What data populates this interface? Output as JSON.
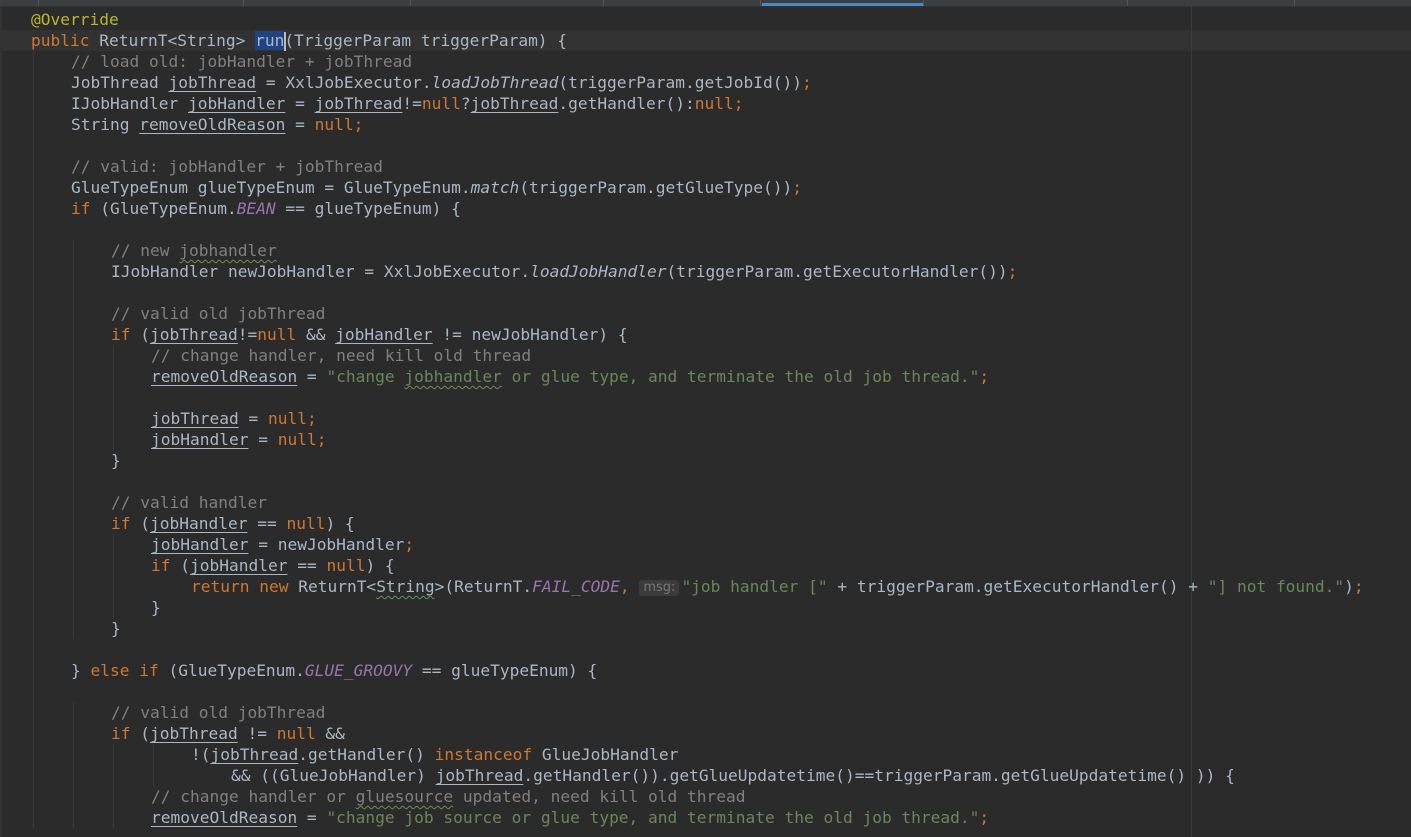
{
  "editor": {
    "language": "Java",
    "colors": {
      "background": "#2b2b2b",
      "keyword": "#cc7832",
      "annotation": "#bbb529",
      "comment": "#808080",
      "string": "#6a8759",
      "static_field": "#9876aa",
      "default_text": "#a9b7c6",
      "selection": "#214283"
    },
    "selected_identifier": "run",
    "parameter_hint": "msg:",
    "lines": [
      {
        "indent": 0,
        "tokens": [
          {
            "t": "@Override",
            "c": "ann"
          }
        ]
      },
      {
        "indent": 0,
        "tokens": [
          {
            "t": "public",
            "c": "kw"
          },
          {
            "t": " ReturnT<String> "
          },
          {
            "t": "run",
            "c": "sel"
          },
          {
            "t": "(TriggerParam triggerParam) {"
          }
        ]
      },
      {
        "indent": 1,
        "tokens": [
          {
            "t": "// load old: jobHandler + jobThread",
            "c": "cmt"
          }
        ]
      },
      {
        "indent": 1,
        "tokens": [
          {
            "t": "JobThread "
          },
          {
            "t": "jobThread",
            "c": "var"
          },
          {
            "t": " = XxlJobExecutor."
          },
          {
            "t": "loadJobThread",
            "c": "italic-method"
          },
          {
            "t": "(triggerParam.getJobId())"
          },
          {
            "t": ";",
            "c": "kw"
          }
        ]
      },
      {
        "indent": 1,
        "tokens": [
          {
            "t": "IJobHandler "
          },
          {
            "t": "jobHandler",
            "c": "var"
          },
          {
            "t": " = "
          },
          {
            "t": "jobThread",
            "c": "var"
          },
          {
            "t": "!="
          },
          {
            "t": "null",
            "c": "kw"
          },
          {
            "t": "?"
          },
          {
            "t": "jobThread",
            "c": "var"
          },
          {
            "t": ".getHandler():"
          },
          {
            "t": "null;",
            "c": "kw"
          }
        ]
      },
      {
        "indent": 1,
        "tokens": [
          {
            "t": "String "
          },
          {
            "t": "removeOldReason",
            "c": "var"
          },
          {
            "t": " = "
          },
          {
            "t": "null;",
            "c": "kw"
          }
        ]
      },
      {
        "indent": 0,
        "tokens": []
      },
      {
        "indent": 1,
        "tokens": [
          {
            "t": "// valid: jobHandler + jobThread",
            "c": "cmt"
          }
        ]
      },
      {
        "indent": 1,
        "tokens": [
          {
            "t": "GlueTypeEnum glueTypeEnum = GlueTypeEnum."
          },
          {
            "t": "match",
            "c": "italic-method"
          },
          {
            "t": "(triggerParam.getGlueType())"
          },
          {
            "t": ";",
            "c": "kw"
          }
        ]
      },
      {
        "indent": 1,
        "tokens": [
          {
            "t": "if",
            "c": "kw"
          },
          {
            "t": " (GlueTypeEnum."
          },
          {
            "t": "BEAN",
            "c": "static-field"
          },
          {
            "t": " == glueTypeEnum) {"
          }
        ]
      },
      {
        "indent": 0,
        "tokens": []
      },
      {
        "indent": 2,
        "tokens": [
          {
            "t": "// new ",
            "c": "cmt"
          },
          {
            "t": "jobhandler",
            "c": "cmt typo"
          }
        ]
      },
      {
        "indent": 2,
        "tokens": [
          {
            "t": "IJobHandler newJobHandler = XxlJobExecutor."
          },
          {
            "t": "loadJobHandler",
            "c": "italic-method"
          },
          {
            "t": "(triggerParam.getExecutorHandler())"
          },
          {
            "t": ";",
            "c": "kw"
          }
        ]
      },
      {
        "indent": 0,
        "tokens": []
      },
      {
        "indent": 2,
        "tokens": [
          {
            "t": "// valid old jobThread",
            "c": "cmt"
          }
        ]
      },
      {
        "indent": 2,
        "tokens": [
          {
            "t": "if",
            "c": "kw"
          },
          {
            "t": " ("
          },
          {
            "t": "jobThread",
            "c": "var"
          },
          {
            "t": "!="
          },
          {
            "t": "null",
            "c": "kw"
          },
          {
            "t": " && "
          },
          {
            "t": "jobHandler",
            "c": "var"
          },
          {
            "t": " != newJobHandler) {"
          }
        ]
      },
      {
        "indent": 3,
        "tokens": [
          {
            "t": "// change handler, need kill old thread",
            "c": "cmt"
          }
        ]
      },
      {
        "indent": 3,
        "tokens": [
          {
            "t": "removeOldReason",
            "c": "var"
          },
          {
            "t": " = "
          },
          {
            "t": "\"change ",
            "c": "str"
          },
          {
            "t": "jobhandler",
            "c": "str typo"
          },
          {
            "t": " or glue type, and terminate the old job thread.\"",
            "c": "str"
          },
          {
            "t": ";",
            "c": "kw"
          }
        ]
      },
      {
        "indent": 0,
        "tokens": []
      },
      {
        "indent": 3,
        "tokens": [
          {
            "t": "jobThread",
            "c": "var"
          },
          {
            "t": " = "
          },
          {
            "t": "null;",
            "c": "kw"
          }
        ]
      },
      {
        "indent": 3,
        "tokens": [
          {
            "t": "jobHandler",
            "c": "var"
          },
          {
            "t": " = "
          },
          {
            "t": "null;",
            "c": "kw"
          }
        ]
      },
      {
        "indent": 2,
        "tokens": [
          {
            "t": "}"
          }
        ]
      },
      {
        "indent": 0,
        "tokens": []
      },
      {
        "indent": 2,
        "tokens": [
          {
            "t": "// valid handler",
            "c": "cmt"
          }
        ]
      },
      {
        "indent": 2,
        "tokens": [
          {
            "t": "if",
            "c": "kw"
          },
          {
            "t": " ("
          },
          {
            "t": "jobHandler",
            "c": "var"
          },
          {
            "t": " == "
          },
          {
            "t": "null",
            "c": "kw"
          },
          {
            "t": ") {"
          }
        ]
      },
      {
        "indent": 3,
        "tokens": [
          {
            "t": "jobHandler",
            "c": "var"
          },
          {
            "t": " = newJobHandler"
          },
          {
            "t": ";",
            "c": "kw"
          }
        ]
      },
      {
        "indent": 3,
        "tokens": [
          {
            "t": "if",
            "c": "kw"
          },
          {
            "t": " ("
          },
          {
            "t": "jobHandler",
            "c": "var"
          },
          {
            "t": " == "
          },
          {
            "t": "null",
            "c": "kw"
          },
          {
            "t": ") {"
          }
        ]
      },
      {
        "indent": 4,
        "tokens": [
          {
            "t": "return new",
            "c": "kw"
          },
          {
            "t": " ReturnT<"
          },
          {
            "t": "String",
            "c": "typo"
          },
          {
            "t": ">(ReturnT."
          },
          {
            "t": "FAIL_CODE",
            "c": "static-field"
          },
          {
            "t": ", ",
            "c": "kw"
          },
          {
            "t": "msg:",
            "c": "hint"
          },
          {
            "t": "\"job handler [\"",
            "c": "str"
          },
          {
            "t": " + triggerParam.getExecutorHandler() + "
          },
          {
            "t": "\"] not found.\"",
            "c": "str"
          },
          {
            "t": ")"
          },
          {
            "t": ";",
            "c": "kw"
          }
        ]
      },
      {
        "indent": 3,
        "tokens": [
          {
            "t": "}"
          }
        ]
      },
      {
        "indent": 2,
        "tokens": [
          {
            "t": "}"
          }
        ]
      },
      {
        "indent": 0,
        "tokens": []
      },
      {
        "indent": 1,
        "tokens": [
          {
            "t": "} "
          },
          {
            "t": "else if",
            "c": "kw"
          },
          {
            "t": " (GlueTypeEnum."
          },
          {
            "t": "GLUE_GROOVY",
            "c": "static-field"
          },
          {
            "t": " == glueTypeEnum) {"
          }
        ]
      },
      {
        "indent": 0,
        "tokens": []
      },
      {
        "indent": 2,
        "tokens": [
          {
            "t": "// valid old jobThread",
            "c": "cmt"
          }
        ]
      },
      {
        "indent": 2,
        "tokens": [
          {
            "t": "if",
            "c": "kw"
          },
          {
            "t": " ("
          },
          {
            "t": "jobThread",
            "c": "var"
          },
          {
            "t": " != "
          },
          {
            "t": "null",
            "c": "kw"
          },
          {
            "t": " &&"
          }
        ]
      },
      {
        "indent": 4,
        "tokens": [
          {
            "t": "!("
          },
          {
            "t": "jobThread",
            "c": "var"
          },
          {
            "t": ".getHandler() "
          },
          {
            "t": "instanceof",
            "c": "kw"
          },
          {
            "t": " GlueJobHandler"
          }
        ]
      },
      {
        "indent": 5,
        "tokens": [
          {
            "t": "&& ((GlueJobHandler) "
          },
          {
            "t": "jobThread",
            "c": "var"
          },
          {
            "t": ".getHandler()).getGlueUpdatetime()==triggerParam.getGlueUpdatetime() )) {"
          }
        ]
      },
      {
        "indent": 3,
        "tokens": [
          {
            "t": "// change handler or ",
            "c": "cmt"
          },
          {
            "t": "gluesource",
            "c": "cmt typo"
          },
          {
            "t": " updated, need kill old thread",
            "c": "cmt"
          }
        ]
      },
      {
        "indent": 3,
        "tokens": [
          {
            "t": "removeOldReason",
            "c": "var"
          },
          {
            "t": " = "
          },
          {
            "t": "\"change job source or glue type, and terminate the old job thread.\"",
            "c": "str"
          },
          {
            "t": ";",
            "c": "kw"
          }
        ]
      }
    ]
  }
}
